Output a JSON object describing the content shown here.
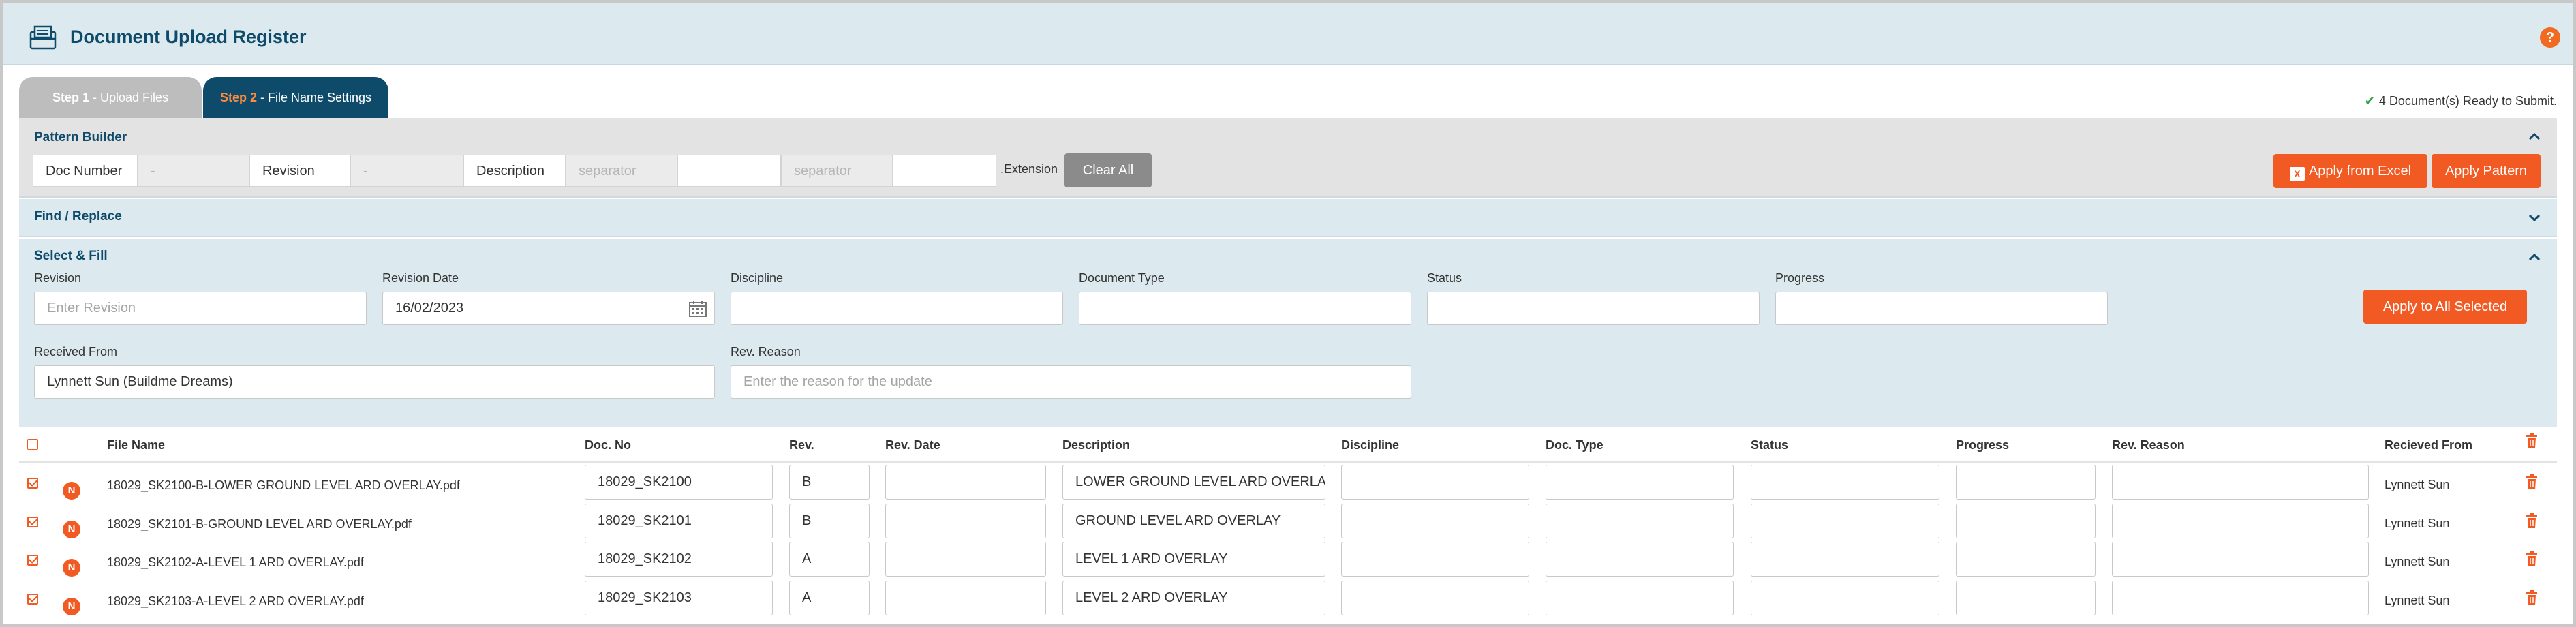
{
  "header": {
    "title": "Document Upload Register",
    "help": "?"
  },
  "tabs": [
    {
      "step": "Step 1",
      "label": " - Upload Files"
    },
    {
      "step": "Step 2",
      "label": " - File Name Settings"
    }
  ],
  "status": {
    "ready_text": "4 Document(s) Ready to Submit."
  },
  "pattern_builder": {
    "title": "Pattern Builder",
    "doc_number_label": "Doc Number",
    "doc_number_value": "-",
    "revision_label": "Revision",
    "revision_value": "-",
    "description_label": "Description",
    "separator1": "separator",
    "separator2": "separator",
    "extension": ".Extension",
    "clear_all": "Clear All",
    "apply_excel": "Apply from Excel",
    "apply_pattern": "Apply Pattern"
  },
  "find_replace": {
    "title": "Find / Replace"
  },
  "select_fill": {
    "title": "Select & Fill",
    "revision_label": "Revision",
    "revision_placeholder": "Enter Revision",
    "revision_date_label": "Revision Date",
    "revision_date_value": "16/02/2023",
    "discipline_label": "Discipline",
    "doc_type_label": "Document Type",
    "status_label": "Status",
    "progress_label": "Progress",
    "apply_all": "Apply to All Selected",
    "received_from_label": "Received From",
    "received_from_value": "Lynnett Sun (Buildme Dreams)",
    "rev_reason_label": "Rev. Reason",
    "rev_reason_placeholder": "Enter the reason for the update"
  },
  "table": {
    "columns": [
      "File Name",
      "Doc. No",
      "Rev.",
      "Rev. Date",
      "Description",
      "Discipline",
      "Doc. Type",
      "Status",
      "Progress",
      "Rev. Reason",
      "Recieved From"
    ],
    "rows": [
      {
        "badge": "N",
        "file_name": "18029_SK2100-B-LOWER GROUND LEVEL ARD OVERLAY.pdf",
        "doc_no": "18029_SK2100",
        "rev": "B",
        "description": "LOWER GROUND LEVEL ARD OVERLA",
        "received_from": "Lynnett Sun"
      },
      {
        "badge": "N",
        "file_name": "18029_SK2101-B-GROUND LEVEL ARD OVERLAY.pdf",
        "doc_no": "18029_SK2101",
        "rev": "B",
        "description": "GROUND LEVEL ARD OVERLAY",
        "received_from": "Lynnett Sun"
      },
      {
        "badge": "N",
        "file_name": "18029_SK2102-A-LEVEL 1 ARD OVERLAY.pdf",
        "doc_no": "18029_SK2102",
        "rev": "A",
        "description": "LEVEL 1 ARD OVERLAY",
        "received_from": "Lynnett Sun"
      },
      {
        "badge": "N",
        "file_name": "18029_SK2103-A-LEVEL 2 ARD OVERLAY.pdf",
        "doc_no": "18029_SK2103",
        "rev": "A",
        "description": "LEVEL 2 ARD OVERLAY",
        "received_from": "Lynnett Sun"
      }
    ]
  },
  "colors": {
    "brand": "#0e4a6a",
    "accent": "#f15a22",
    "panel": "#dce9ee"
  },
  "icons": [
    "document-register-icon",
    "help-icon",
    "check-icon",
    "chevron-up-icon",
    "chevron-down-icon",
    "calendar-icon",
    "excel-icon",
    "trash-icon"
  ]
}
